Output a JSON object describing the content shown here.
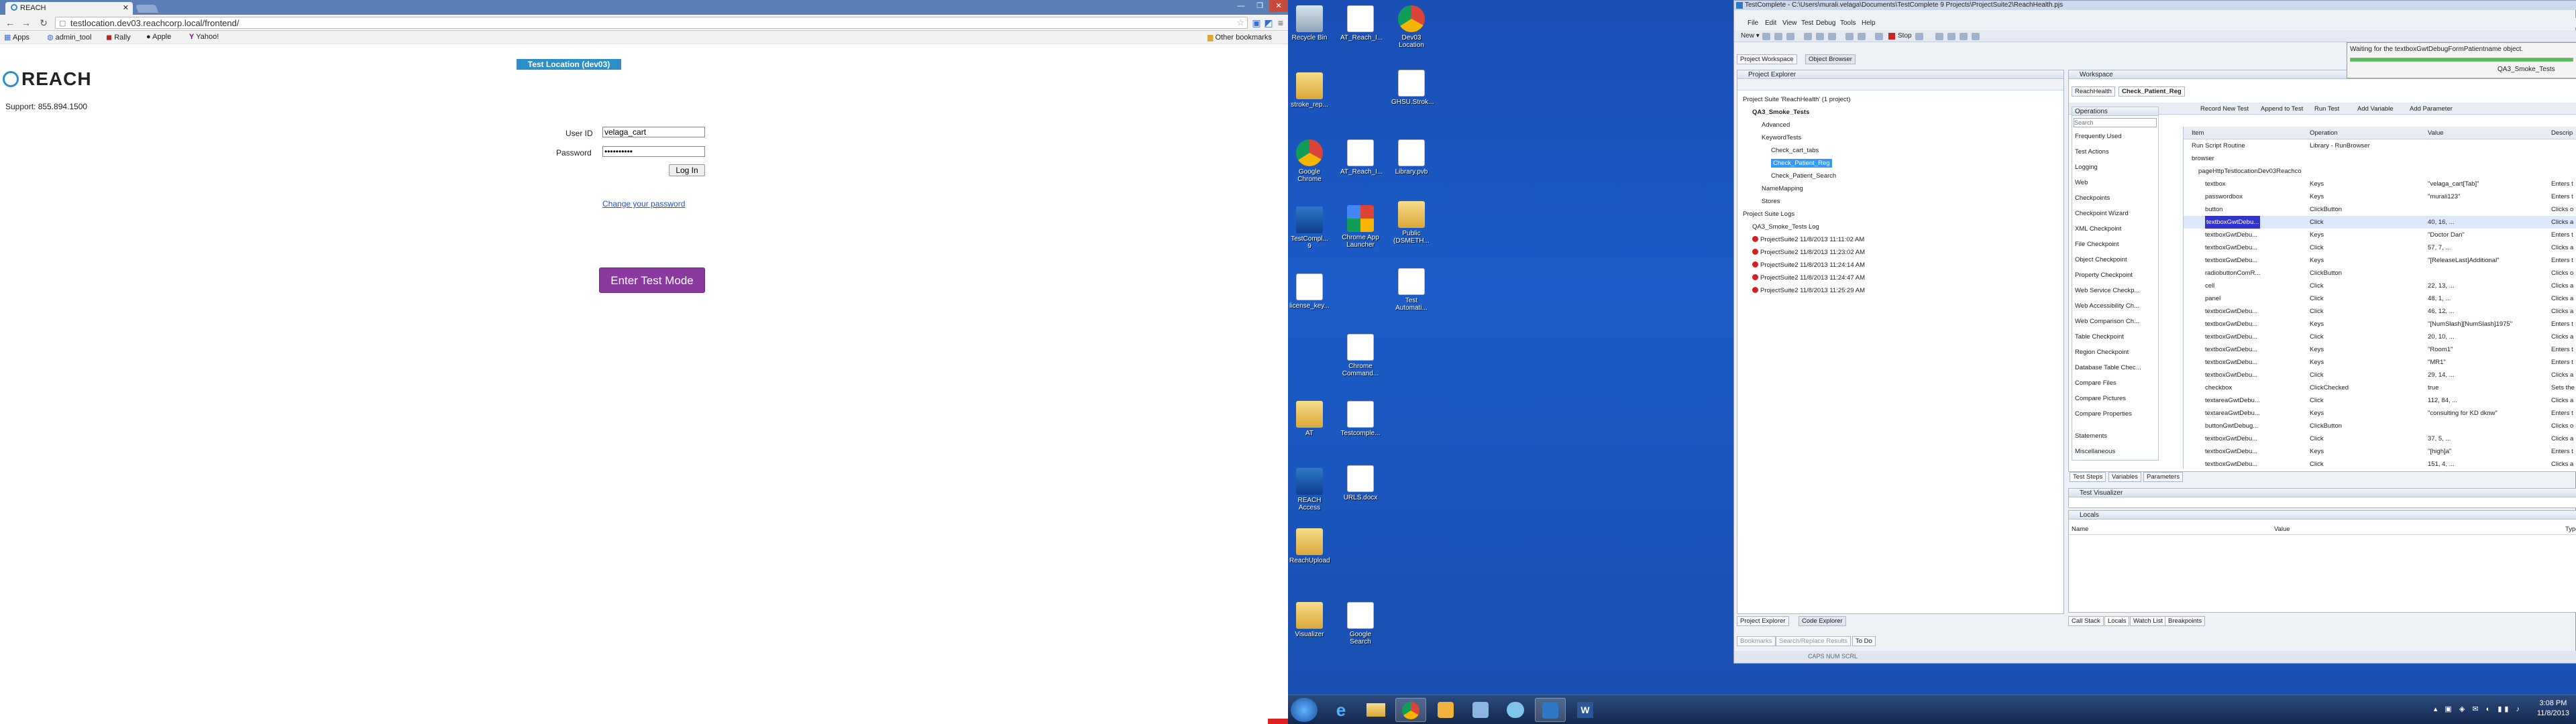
{
  "browser": {
    "tab_title": "REACH",
    "url": "testlocation.dev03.reachcorp.local/frontend/",
    "bookmarks": [
      "Apps",
      "admin_tool",
      "Rally",
      "Apple",
      "Yahoo!"
    ],
    "other_bookmarks": "Other bookmarks"
  },
  "page": {
    "logo_text": "REACH",
    "support": "Support: 855.894.1500",
    "test_location": "Test Location (dev03)",
    "userid_label": "User ID",
    "userid_value": "velaga_cart",
    "password_label": "Password",
    "password_value": "••••••••••",
    "login_button": "Log In",
    "change_password": "Change your password",
    "enter_test_mode": "Enter Test Mode"
  },
  "desktop": {
    "icons": [
      {
        "label": "Recycle Bin"
      },
      {
        "label": "AT_Reach_I..."
      },
      {
        "label": "stroke_rep..."
      },
      {
        "label": "Google Chrome"
      },
      {
        "label": "AT_Reach_I..."
      },
      {
        "label": "TestCompl... 9"
      },
      {
        "label": "Chrome App Launcher"
      },
      {
        "label": "license_key..."
      },
      {
        "label": "Chrome Command..."
      },
      {
        "label": "AT"
      },
      {
        "label": "Testcomple..."
      },
      {
        "label": "REACH Access"
      },
      {
        "label": "URLS.docx"
      },
      {
        "label": "ReachUpload"
      },
      {
        "label": "Visualizer"
      },
      {
        "label": "Google Search"
      },
      {
        "label": "Dev03 Location"
      },
      {
        "label": "GHSU.Strok..."
      },
      {
        "label": "Library.pvb"
      },
      {
        "label": "Public (DSMETH..."
      },
      {
        "label": "Test Automati..."
      }
    ]
  },
  "taskbar": {
    "time": "3:08 PM",
    "date": "11/8/2013"
  },
  "tc": {
    "title": "TestComplete - C:\\Users\\murali.velaga\\Documents\\TestComplete 9 Projects\\ProjectSuite2\\ReachHealth.pjs",
    "menus": [
      "File",
      "Edit",
      "View",
      "Test",
      "Debug",
      "Tools",
      "Help"
    ],
    "new_label": "New",
    "stop_label": "Stop",
    "ws_tabs": [
      "Project Workspace",
      "Object Browser"
    ],
    "project_explorer": "Project Explorer",
    "workspace": "Workspace",
    "editor_tabs": [
      "ReachHealth",
      "Check_Patient_Reg"
    ],
    "editor_toolbar": [
      "Record New Test",
      "Append to Test",
      "Run Test",
      "Add Variable",
      "Add Parameter"
    ],
    "tree": [
      "Project Suite 'ReachHealth' (1 project)",
      "QA3_Smoke_Tests",
      "Advanced",
      "KeywordTests",
      "Check_cart_tabs",
      "Check_Patient_Reg",
      "Check_Patient_Search",
      "NameMapping",
      "Stores",
      "Project Suite Logs",
      "QA3_Smoke_Tests Log",
      "ProjectSuite2 11/8/2013 11:11:02 AM",
      "ProjectSuite2 11/8/2013 11:23:02 AM",
      "ProjectSuite2 11/8/2013 11:24:14 AM",
      "ProjectSuite2 11/8/2013 11:24:47 AM",
      "ProjectSuite2 11/8/2013 11:25:29 AM"
    ],
    "operations_header": "Operations",
    "search_placeholder": "Search",
    "operations": [
      "Frequently Used",
      "Test Actions",
      "Logging",
      "Web",
      "Checkpoints",
      "Checkpoint Wizard",
      "XML Checkpoint",
      "File Checkpoint",
      "Object Checkpoint",
      "Property Checkpoint",
      "Web Service Checkp...",
      "Web Accessibility Ch...",
      "Web Comparison Ch...",
      "Table Checkpoint",
      "Region Checkpoint",
      "Database Table Chec...",
      "Compare Files",
      "Compare Pictures",
      "Compare Properties",
      "Statements",
      "Miscellaneous"
    ],
    "grid_headers": [
      "Item",
      "Operation",
      "Value",
      "Descrip"
    ],
    "grid_rows": [
      [
        "Run Script Routine",
        "Library - RunBrowser",
        "",
        ""
      ],
      [
        "browser",
        "",
        "",
        ""
      ],
      [
        "pageHttpTestlocationDev03Reachco",
        "",
        "",
        ""
      ],
      [
        "textbox",
        "Keys",
        "\"velaga_cart[Tab]\"",
        "Enters t"
      ],
      [
        "passwordbox",
        "Keys",
        "\"murali123\"",
        "Enters t"
      ],
      [
        "button",
        "ClickButton",
        "",
        "Clicks o"
      ],
      [
        "textboxGwtDebu...",
        "Click",
        "40, 16, ...",
        "Clicks a"
      ],
      [
        "textboxGwtDebu...",
        "Keys",
        "\"Doctor Dan\"",
        "Enters t"
      ],
      [
        "textboxGwtDebu...",
        "Click",
        "57, 7, ...",
        "Clicks a"
      ],
      [
        "textboxGwtDebu...",
        "Keys",
        "\"[ReleaseLast]Additional\"",
        "Enters t"
      ],
      [
        "radiobuttonComR...",
        "ClickButton",
        "",
        "Clicks o"
      ],
      [
        "cell",
        "Click",
        "22, 13, ...",
        "Clicks a"
      ],
      [
        "panel",
        "Click",
        "48, 1, ...",
        "Clicks a"
      ],
      [
        "textboxGwtDebu...",
        "Click",
        "46, 12, ...",
        "Clicks a"
      ],
      [
        "textboxGwtDebu...",
        "Keys",
        "\"[NumSlash][NumSlash]1975\"",
        "Enters t"
      ],
      [
        "textboxGwtDebu...",
        "Click",
        "20, 10, ...",
        "Clicks a"
      ],
      [
        "textboxGwtDebu...",
        "Keys",
        "\"Room1\"",
        "Enters t"
      ],
      [
        "textboxGwtDebu...",
        "Keys",
        "\"MR1\"",
        "Enters t"
      ],
      [
        "textboxGwtDebu...",
        "Click",
        "29, 14, ...",
        "Clicks a"
      ],
      [
        "checkbox",
        "ClickChecked",
        "true",
        "Sets the"
      ],
      [
        "textareaGwtDebu...",
        "Click",
        "112, 84, ...",
        "Clicks a"
      ],
      [
        "textareaGwtDebu...",
        "Keys",
        "\"consulting for KD dknw\"",
        "Enters t"
      ],
      [
        "buttonGwtDebug...",
        "ClickButton",
        "",
        "Clicks o"
      ],
      [
        "textboxGwtDebu...",
        "Click",
        "37, 5, ...",
        "Clicks a"
      ],
      [
        "textboxGwtDebu...",
        "Keys",
        "\"[high]a\"",
        "Enters t"
      ],
      [
        "textboxGwtDebu...",
        "Click",
        "151, 4, ...",
        "Clicks a"
      ]
    ],
    "bottom_tabs": [
      "Test Steps",
      "Variables",
      "Parameters"
    ],
    "test_visualizer": "Test Visualizer",
    "locals_header": "Locals",
    "locals_columns": [
      "Name",
      "Value",
      "Type"
    ],
    "left_bottom_tabs": [
      "Project Explorer",
      "Code Explorer"
    ],
    "debug_tabs": [
      "Call Stack",
      "Locals",
      "Watch List",
      "Breakpoints"
    ],
    "status_tabs": [
      "Bookmarks",
      "Search/Replace Results",
      "To Do"
    ],
    "status_caps": "CAPS  NUM  SCRL",
    "waiting_text": "Waiting for the textboxGwtDebugFormPatientname object.",
    "waiting_test": "QA3_Smoke_Tests"
  }
}
